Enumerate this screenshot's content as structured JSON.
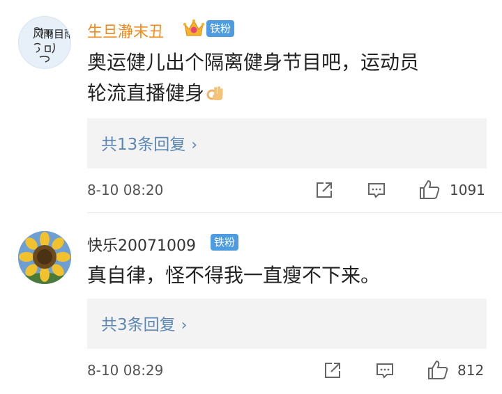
{
  "comments": [
    {
      "username": "生旦瀞末丑",
      "badge": "铁粉",
      "avatar_text": "风雨目雨",
      "text_line1": "奥运健儿出个隔离健身节目吧，运动员",
      "text_line2": "轮流直播健身",
      "replies": "共13条回复",
      "time": "8-10 08:20",
      "likes": "1091",
      "icons": [
        "crown-icon",
        "ok-hand-emoji",
        "share-icon",
        "comment-icon",
        "thumbs-up-icon"
      ]
    },
    {
      "username": "快乐20071009",
      "badge": "铁粉",
      "text_line1": "真自律，怪不得我一直瘦不下来。",
      "replies": "共3条回复",
      "time": "8-10 08:29",
      "likes": "812",
      "icons": [
        "sunflower-avatar",
        "share-icon",
        "comment-icon",
        "thumbs-up-icon"
      ]
    }
  ],
  "colors": {
    "username_vip": "#f08a1c",
    "badge_bg": "#4d9be0",
    "reply_link": "#5b87b2"
  }
}
